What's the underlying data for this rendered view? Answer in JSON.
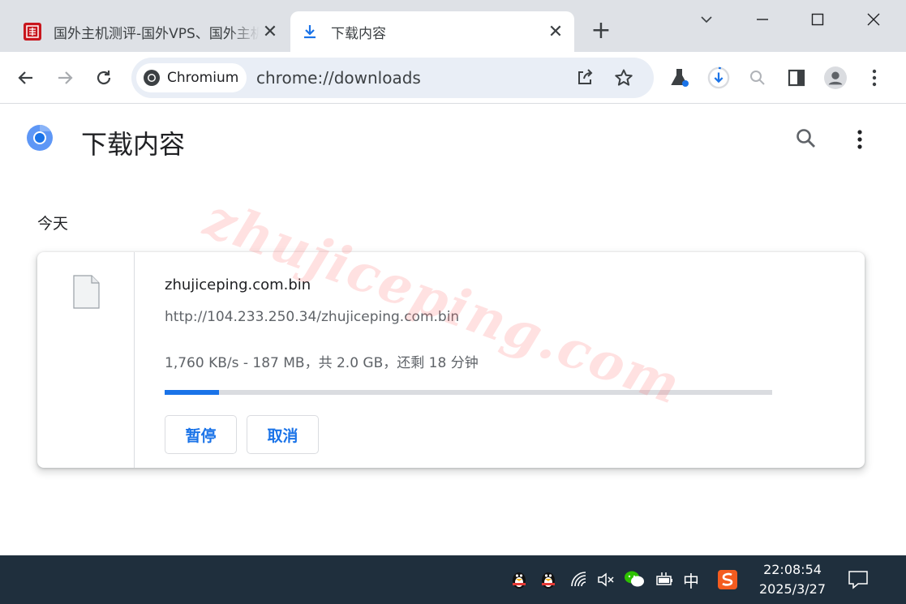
{
  "tabs": [
    {
      "title": "国外主机测评-国外VPS、国外主机",
      "icon": "site-favicon",
      "active": false
    },
    {
      "title": "下载内容",
      "icon": "download-icon",
      "active": true
    }
  ],
  "omnibox": {
    "chip_label": "Chromium",
    "url": "chrome://downloads"
  },
  "page": {
    "title": "下载内容",
    "section": "今天",
    "download": {
      "filename": "zhujiceping.com.bin",
      "source_url": "http://104.233.250.34/zhujiceping.com.bin",
      "status": "1,760 KB/s - 187 MB，共 2.0 GB，还剩 18 分钟",
      "progress": 0.09,
      "pause_label": "暂停",
      "cancel_label": "取消"
    }
  },
  "watermark": "zhujiceping.com",
  "taskbar": {
    "ime_label": "中",
    "time": "22:08:54",
    "date": "2025/3/27"
  },
  "colors": {
    "accent": "#1a73e8",
    "tabstrip": "#dee1e6",
    "taskbar": "#1f2f3d"
  }
}
